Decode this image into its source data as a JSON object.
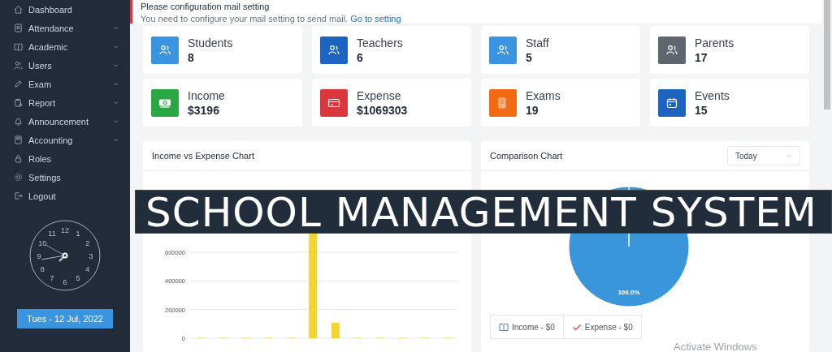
{
  "sidebar": {
    "items": [
      {
        "label": "Dashboard",
        "expandable": false
      },
      {
        "label": "Attendance",
        "expandable": true
      },
      {
        "label": "Academic",
        "expandable": true
      },
      {
        "label": "Users",
        "expandable": true
      },
      {
        "label": "Exam",
        "expandable": true
      },
      {
        "label": "Report",
        "expandable": true
      },
      {
        "label": "Announcement",
        "expandable": true
      },
      {
        "label": "Accounting",
        "expandable": true
      },
      {
        "label": "Roles",
        "expandable": false
      },
      {
        "label": "Settings",
        "expandable": false
      },
      {
        "label": "Logout",
        "expandable": false
      }
    ],
    "clock": {
      "numbers": [
        "12",
        "1",
        "2",
        "3",
        "4",
        "5",
        "6",
        "7",
        "8",
        "9",
        "10",
        "11"
      ]
    },
    "date_button": "Tues - 12 Jul, 2022"
  },
  "alert": {
    "title": "Please configuration mail setting",
    "message": "You need to configure your mail setting to send mail.",
    "link": "Go to setting"
  },
  "stats": [
    {
      "label": "Students",
      "value": "8",
      "color": "#3b94e0"
    },
    {
      "label": "Teachers",
      "value": "6",
      "color": "#1d63c0"
    },
    {
      "label": "Staff",
      "value": "5",
      "color": "#3b94e0"
    },
    {
      "label": "Parents",
      "value": "17",
      "color": "#5f6670"
    },
    {
      "label": "Income",
      "value": "$3196",
      "color": "#2aa743"
    },
    {
      "label": "Expense",
      "value": "$1069303",
      "color": "#d9363e"
    },
    {
      "label": "Exams",
      "value": "19",
      "color": "#f26b12"
    },
    {
      "label": "Events",
      "value": "15",
      "color": "#1d63c0"
    }
  ],
  "income_chart": {
    "title": "Income vs Expense Chart",
    "y_labels": [
      "600000",
      "400000",
      "200000",
      "0"
    ]
  },
  "comparison_chart": {
    "title": "Comparison Chart",
    "period": "Today",
    "slice_label": "100.0%",
    "legend": [
      "Income - $0",
      "Expense - $0"
    ]
  },
  "banner": "SCHOOL MANAGEMENT SYSTEM",
  "os_notice": "Activate Windows"
}
